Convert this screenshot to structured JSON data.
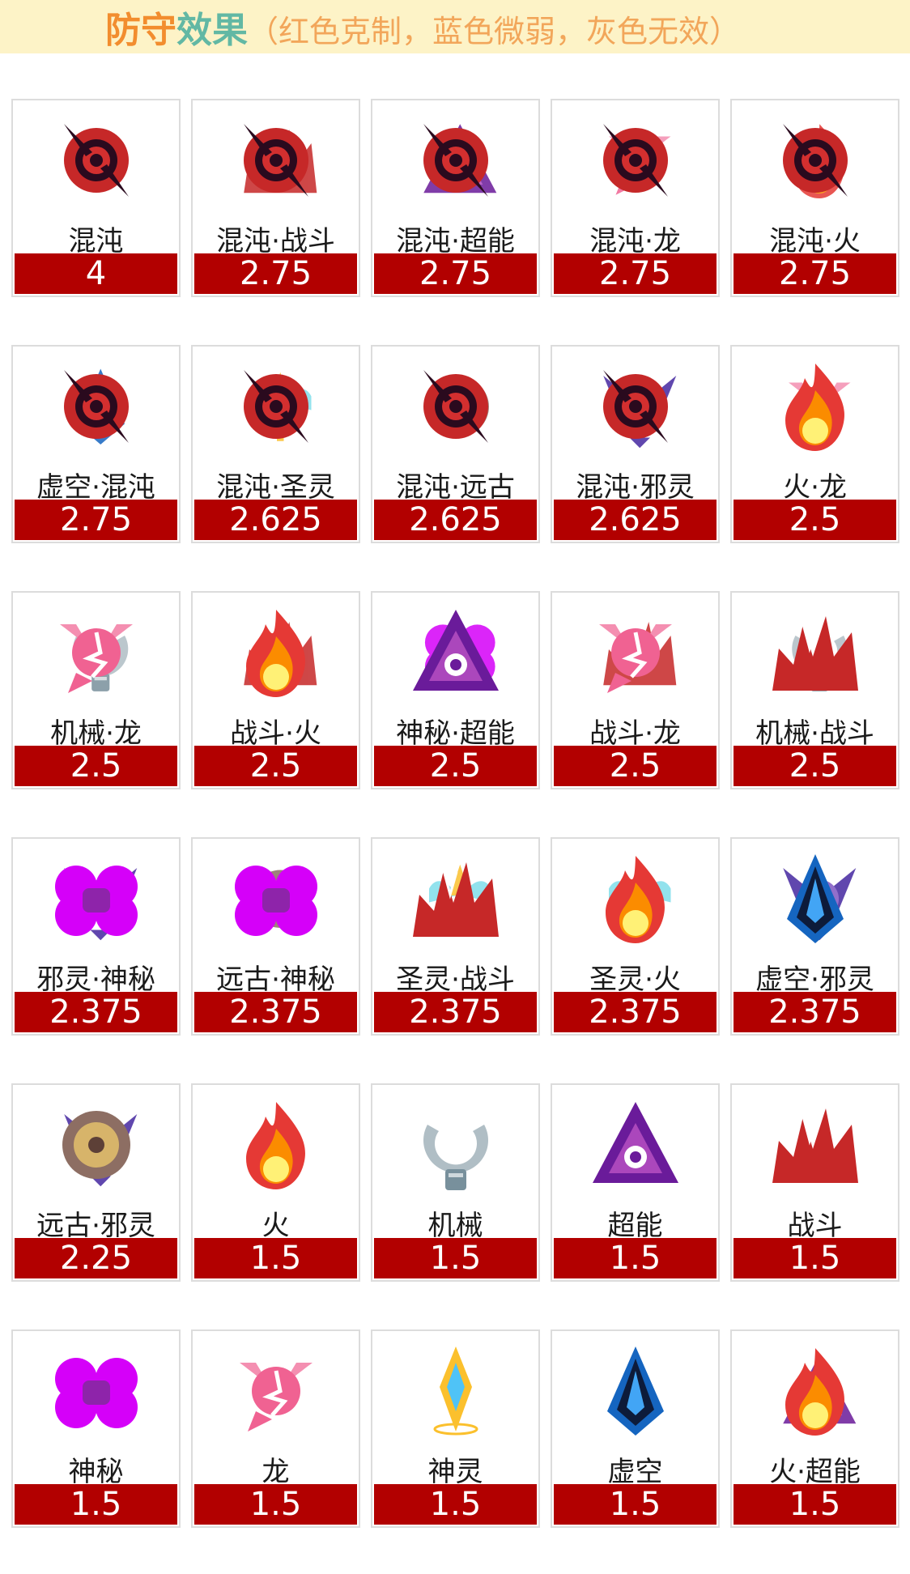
{
  "header": {
    "title_part1": "防守",
    "title_part2": "效果",
    "subtitle": "（红色克制，蓝色微弱，灰色无效）"
  },
  "colors": {
    "header_bg": "#fdf3c7",
    "value_bar": "#b20000"
  },
  "cards": [
    {
      "label": "混沌",
      "value": "4",
      "icon": "chaos-icon"
    },
    {
      "label": "混沌·战斗",
      "value": "2.75",
      "icon": "chaos-fighting-icon"
    },
    {
      "label": "混沌·超能",
      "value": "2.75",
      "icon": "chaos-psychic-icon"
    },
    {
      "label": "混沌·龙",
      "value": "2.75",
      "icon": "chaos-dragon-icon"
    },
    {
      "label": "混沌·火",
      "value": "2.75",
      "icon": "chaos-fire-icon"
    },
    {
      "label": "虚空·混沌",
      "value": "2.75",
      "icon": "void-chaos-icon"
    },
    {
      "label": "混沌·圣灵",
      "value": "2.625",
      "icon": "chaos-holy-icon"
    },
    {
      "label": "混沌·远古",
      "value": "2.625",
      "icon": "chaos-ancient-icon"
    },
    {
      "label": "混沌·邪灵",
      "value": "2.625",
      "icon": "chaos-evil-icon"
    },
    {
      "label": "火·龙",
      "value": "2.5",
      "icon": "fire-dragon-icon"
    },
    {
      "label": "机械·龙",
      "value": "2.5",
      "icon": "mech-dragon-icon"
    },
    {
      "label": "战斗·火",
      "value": "2.5",
      "icon": "fighting-fire-icon"
    },
    {
      "label": "神秘·超能",
      "value": "2.5",
      "icon": "mystic-psychic-icon"
    },
    {
      "label": "战斗·龙",
      "value": "2.5",
      "icon": "fighting-dragon-icon"
    },
    {
      "label": "机械·战斗",
      "value": "2.5",
      "icon": "mech-fighting-icon"
    },
    {
      "label": "邪灵·神秘",
      "value": "2.375",
      "icon": "evil-mystic-icon"
    },
    {
      "label": "远古·神秘",
      "value": "2.375",
      "icon": "ancient-mystic-icon"
    },
    {
      "label": "圣灵·战斗",
      "value": "2.375",
      "icon": "holy-fighting-icon"
    },
    {
      "label": "圣灵·火",
      "value": "2.375",
      "icon": "holy-fire-icon"
    },
    {
      "label": "虚空·邪灵",
      "value": "2.375",
      "icon": "void-evil-icon"
    },
    {
      "label": "远古·邪灵",
      "value": "2.25",
      "icon": "ancient-evil-icon"
    },
    {
      "label": "火",
      "value": "1.5",
      "icon": "fire-icon"
    },
    {
      "label": "机械",
      "value": "1.5",
      "icon": "mech-icon"
    },
    {
      "label": "超能",
      "value": "1.5",
      "icon": "psychic-icon"
    },
    {
      "label": "战斗",
      "value": "1.5",
      "icon": "fighting-icon"
    },
    {
      "label": "神秘",
      "value": "1.5",
      "icon": "mystic-icon"
    },
    {
      "label": "龙",
      "value": "1.5",
      "icon": "dragon-icon"
    },
    {
      "label": "神灵",
      "value": "1.5",
      "icon": "divine-icon"
    },
    {
      "label": "虚空",
      "value": "1.5",
      "icon": "void-icon"
    },
    {
      "label": "火·超能",
      "value": "1.5",
      "icon": "fire-psychic-icon"
    }
  ]
}
